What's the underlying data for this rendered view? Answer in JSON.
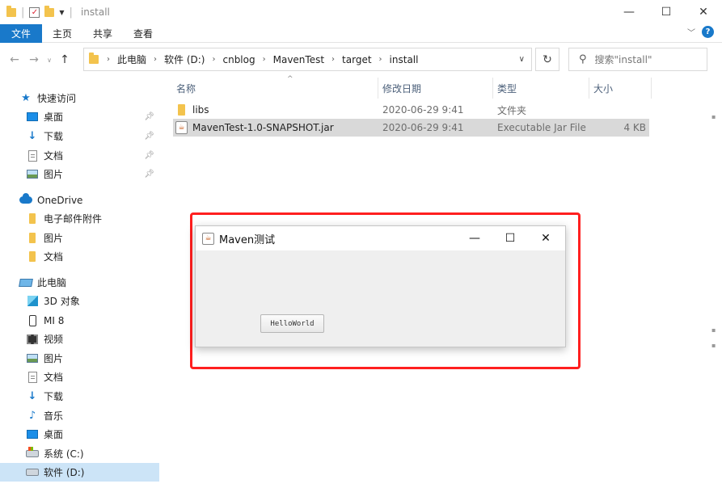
{
  "titlebar": {
    "title": "install",
    "controls": {
      "minimize": "—",
      "maximize": "☐",
      "close": "✕"
    }
  },
  "ribbon": {
    "tabs": [
      "文件",
      "主页",
      "共享",
      "查看"
    ],
    "help": "?"
  },
  "address": {
    "crumbs": [
      "此电脑",
      "软件 (D:)",
      "cnblog",
      "MavenTest",
      "target",
      "install"
    ]
  },
  "search": {
    "placeholder": "搜索\"install\""
  },
  "nav": {
    "quick_access": "快速访问",
    "desktop": "桌面",
    "downloads": "下载",
    "documents": "文档",
    "pictures": "图片",
    "onedrive": "OneDrive",
    "email_attachments": "电子邮件附件",
    "od_pictures": "图片",
    "od_documents": "文档",
    "this_pc": "此电脑",
    "objects3d": "3D 对象",
    "mi8": "MI 8",
    "videos": "视频",
    "pc_pictures": "图片",
    "pc_documents": "文档",
    "pc_downloads": "下载",
    "music": "音乐",
    "pc_desktop": "桌面",
    "system_c": "系统 (C:)",
    "software_d": "软件 (D:)"
  },
  "columns": {
    "name": "名称",
    "date": "修改日期",
    "type": "类型",
    "size": "大小"
  },
  "files": [
    {
      "name": "libs",
      "date": "2020-06-29 9:41",
      "type": "文件夹",
      "size": ""
    },
    {
      "name": "MavenTest-1.0-SNAPSHOT.jar",
      "date": "2020-06-29 9:41",
      "type": "Executable Jar File",
      "size": "4 KB"
    }
  ],
  "java_window": {
    "title": "Maven测试",
    "button_label": "HelloWorld",
    "controls": {
      "minimize": "—",
      "maximize": "☐",
      "close": "✕"
    }
  }
}
